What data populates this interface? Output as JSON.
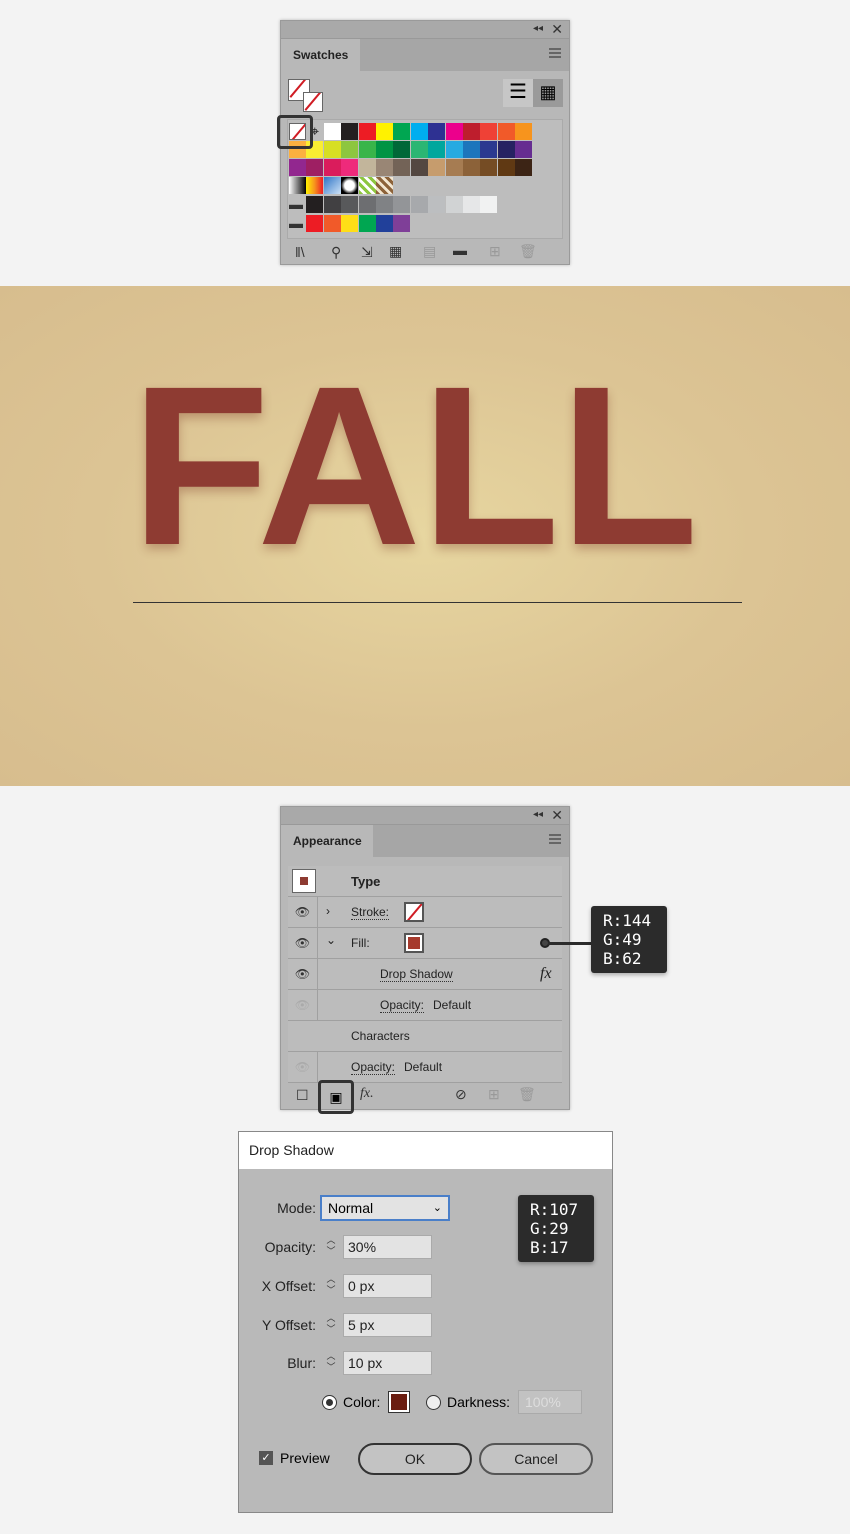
{
  "swatches_panel": {
    "tab": "Swatches",
    "rows": [
      [
        "none",
        "registration",
        "#ffffff",
        "#231f20",
        "#ed1c24",
        "#fff200",
        "#00a651",
        "#00aeef",
        "#2e3192",
        "#ec008c",
        "#be1e2d",
        "#ef4136",
        "#f15a29",
        "#f7941d"
      ],
      [
        "#fbb040",
        "#f9ed32",
        "#d7df23",
        "#8dc63f",
        "#39b54a",
        "#009444",
        "#006838",
        "#2bb673",
        "#00a79d",
        "#27aae1",
        "#1c75bc",
        "#2b3990",
        "#262262",
        "#662d91"
      ],
      [
        "#92278f",
        "#9e1f63",
        "#da1c5c",
        "#ee2a7b",
        "#c2b59b",
        "#998675",
        "#736357",
        "#534741",
        "#c69c6d",
        "#a67c52",
        "#8c6239",
        "#754c24",
        "#603913",
        "#3c2415"
      ],
      [
        "linear-gradient(90deg,#fff,#000)",
        "linear-gradient(90deg,#fff200,#f7941d,#ed1c24)",
        "linear-gradient(135deg,#2e74c6,#cfe3f7)",
        "radial-gradient(circle,#fff 40%,#000 70%)",
        "repeating-linear-gradient(45deg,#8dc63f 0 3px,#fff 3px 6px)",
        "repeating-linear-gradient(45deg,#8c6239 0 3px,#f3e6d0 3px 6px)"
      ],
      [
        "folder",
        "#231f20",
        "#414042",
        "#58595b",
        "#6d6e71",
        "#808285",
        "#939598",
        "#a7a9ac",
        "#bcbec0",
        "#d1d3d4",
        "#e6e7e8",
        "#f1f2f2"
      ],
      [
        "folder",
        "#ed1c24",
        "#f15a29",
        "#ffde17",
        "#00a651",
        "#21409a",
        "#7f3f98"
      ]
    ]
  },
  "canvas": {
    "text": "FALL",
    "background": "#dcc494",
    "text_color": "#8e3b32"
  },
  "appearance_panel": {
    "tab": "Appearance",
    "type_label": "Type",
    "stroke_label": "Stroke:",
    "fill_label": "Fill:",
    "drop_shadow_label": "Drop Shadow",
    "fx_label": "fx",
    "opacity_label": "Opacity:",
    "opacity_value": "Default",
    "characters_label": "Characters",
    "opacity2_label": "Opacity:",
    "opacity2_value": "Default",
    "fill_color": "#90313e"
  },
  "fill_tooltip": {
    "r": "R:144",
    "g": "G:49",
    "b": "B:62"
  },
  "drop_shadow_dialog": {
    "title": "Drop Shadow",
    "mode_label": "Mode:",
    "mode_value": "Normal",
    "opacity_label": "Opacity:",
    "opacity_value": "30%",
    "x_offset_label": "X Offset:",
    "x_offset_value": "0 px",
    "y_offset_label": "Y Offset:",
    "y_offset_value": "5 px",
    "blur_label": "Blur:",
    "blur_value": "10 px",
    "color_label": "Color:",
    "darkness_label": "Darkness:",
    "darkness_value": "100%",
    "color": "#6b1d11",
    "preview_label": "Preview",
    "ok_label": "OK",
    "cancel_label": "Cancel"
  },
  "shadow_tooltip": {
    "r": "R:107",
    "g": "G:29",
    "b": "B:17"
  }
}
